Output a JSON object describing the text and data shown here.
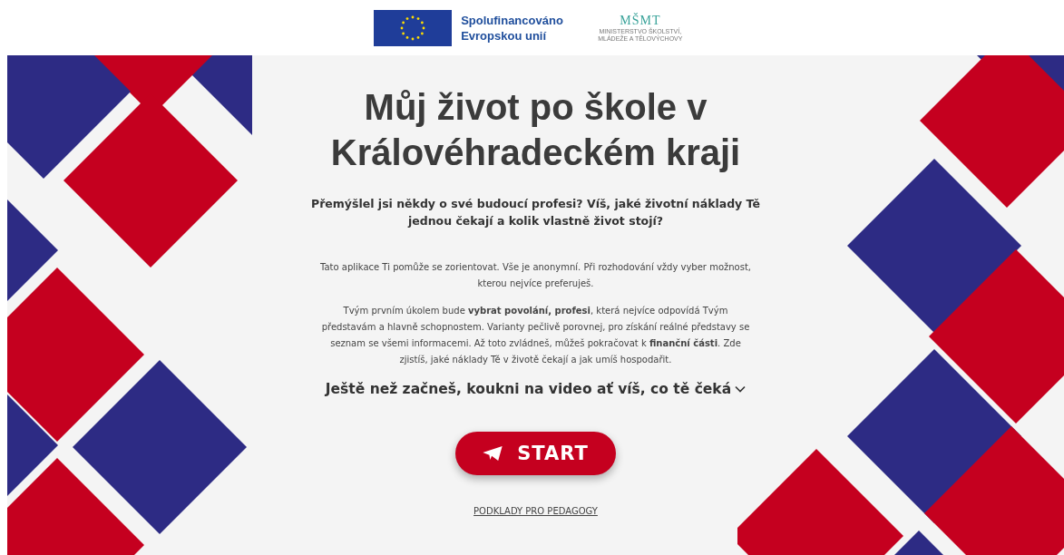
{
  "header": {
    "eu_logo": {
      "lines": [
        "Spolufinancováno",
        "Evropskou unií"
      ]
    },
    "ministry_logo": {
      "mark": "MŠMT",
      "lines": [
        "MINISTERSTVO ŠKOLSTVÍ,",
        "MLÁDEŽE A TĚLOVÝCHOVY"
      ]
    }
  },
  "hero": {
    "title": "Můj život po škole v Královéhradeckém kraji",
    "subtitle": "Přemýšlel jsi někdy o své budoucí profesi? Víš, jaké životní náklady Tě jednou čekají a kolik vlastně život stojí?",
    "paragraphs": [
      "Tato aplikace Ti pomůže se zorientovat. Vše je anonymní. Při rozhodování vždy vyber možnost, kterou nejvíce preferuješ.",
      "Tvým prvním úkolem bude **vybrat povolání, profesi**, která nejvíce odpovídá Tvým představám a hlavně schopnostem. Varianty pečlivě porovnej, pro získání reálné představy se seznam se všemi informacemi. Až toto zvládneš, můžeš pokračovat k **finanční části**. Zde zjistíš, jaké náklady Tě v životě čekají a jak umíš hospodařit."
    ],
    "video_toggle": {
      "label": "Ještě než začneš, koukni na video ať víš, co tě čeká",
      "expanded": false
    },
    "start_button": "START",
    "teacher_link": "PODKLADY PRO PEDAGOGY"
  }
}
